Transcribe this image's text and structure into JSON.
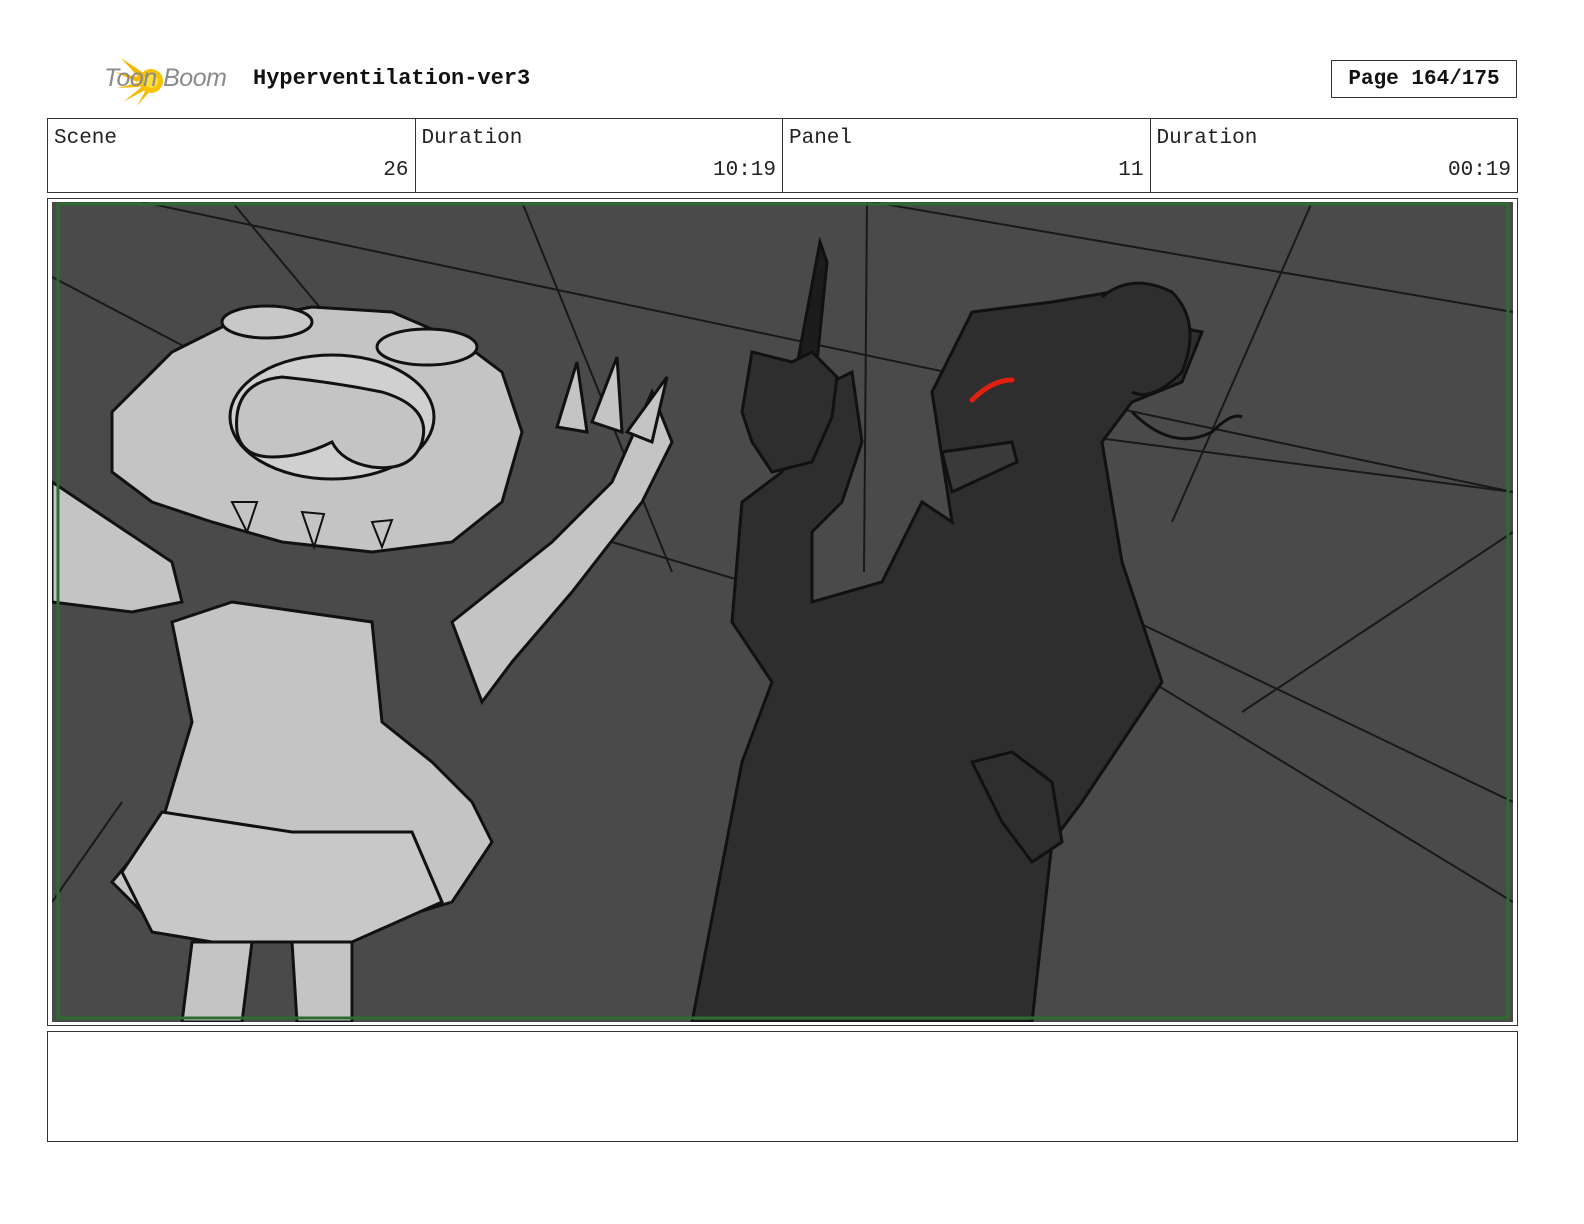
{
  "header": {
    "brand": "Toon Boom",
    "project_title": "Hyperventilation-ver3",
    "page_label": "Page 164/175"
  },
  "info": {
    "scene_label": "Scene",
    "scene_value": "26",
    "scene_duration_label": "Duration",
    "scene_duration_value": "10:19",
    "panel_label": "Panel",
    "panel_value": "11",
    "panel_duration_label": "Duration",
    "panel_duration_value": "00:19"
  },
  "panel": {
    "image_subject": "storyboard-sketch",
    "frame_color": "#2e6b2e",
    "background_color": "#4a4a4a",
    "eye_color": "#e02010"
  },
  "notes": {
    "text": ""
  }
}
